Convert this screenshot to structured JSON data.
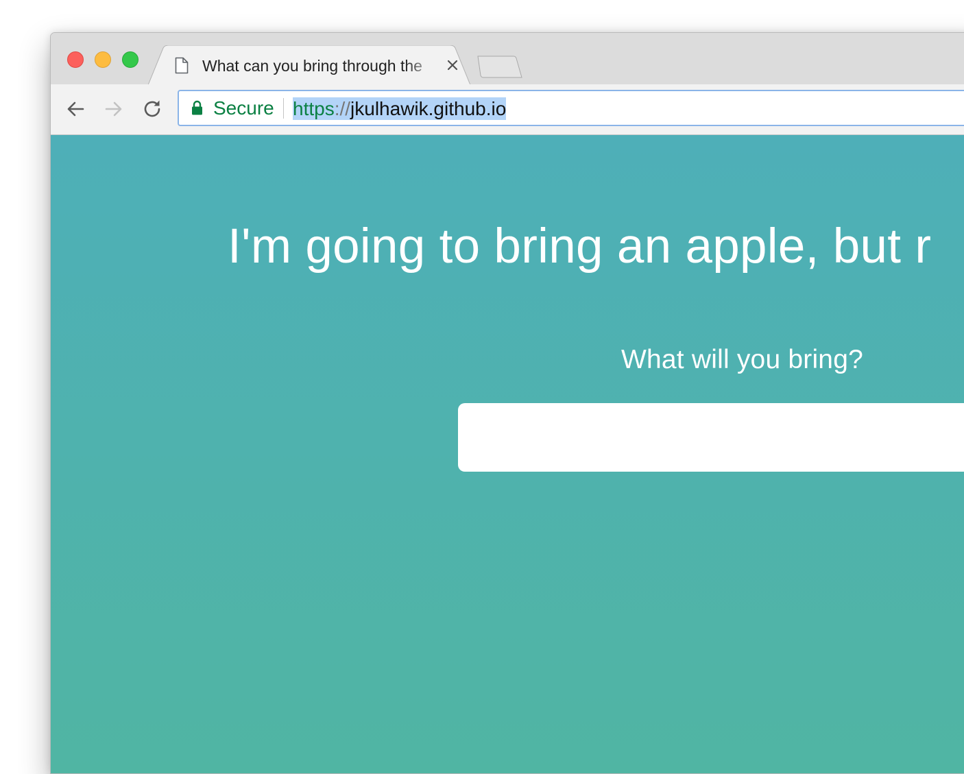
{
  "browser": {
    "tab": {
      "title": "What can you bring through the",
      "favicon": "document-icon"
    },
    "omnibox": {
      "security_label": "Secure",
      "url_scheme": "https",
      "url_separator": "://",
      "url_host": "jkulhawik.github.io"
    },
    "colors": {
      "secure_green": "#0b8043",
      "selection": "#b3d4f8",
      "focus_ring": "#8ab4e8"
    }
  },
  "page": {
    "headline": "I'm going to bring an apple, but r",
    "prompt": "What will you bring?",
    "answer_value": "",
    "colors": {
      "gradient_top": "#4eafb8",
      "gradient_bottom": "#50b5a3",
      "text": "#ffffff"
    }
  }
}
